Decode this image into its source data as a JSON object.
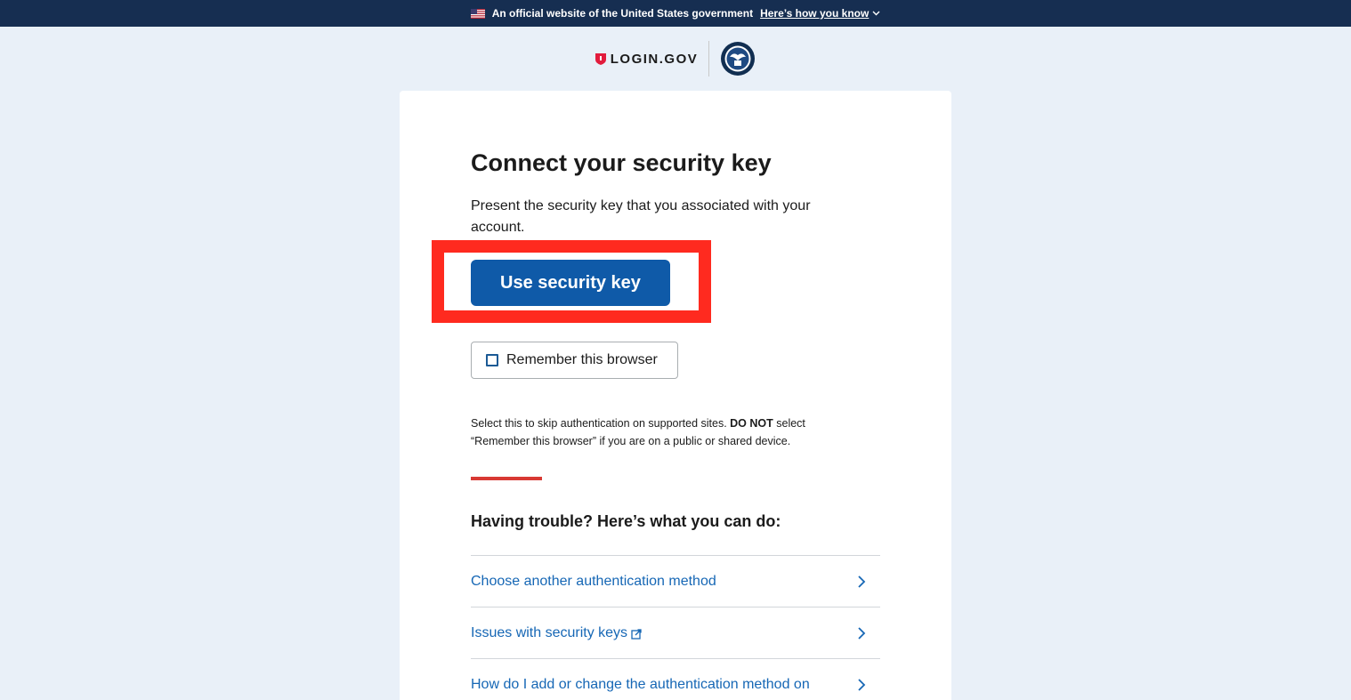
{
  "banner": {
    "official_text": "An official website of the United States government",
    "how_link": "Here’s how you know",
    "flag_icon": "us-flag-icon"
  },
  "header": {
    "logo_text": "LOGIN.GOV",
    "logo_icon": "login-shield-icon",
    "seal": "agency-seal"
  },
  "main": {
    "title": "Connect your security key",
    "intro": "Present the security key that you associated with your account.",
    "primary_button": "Use security key",
    "remember_label": "Remember this browser",
    "remember_checked": false,
    "hint_part1": "Select this to skip authentication on supported sites. ",
    "hint_bold": "DO NOT",
    "hint_part2": " select “Remember this browser” if you are on a public or shared device."
  },
  "trouble": {
    "heading": "Having trouble? Here’s what you can do:",
    "items": [
      {
        "label": "Choose another authentication method",
        "external": false
      },
      {
        "label": "Issues with security keys",
        "external": true
      },
      {
        "label": "How do I add or change the authentication method on",
        "external": false
      }
    ]
  },
  "colors": {
    "banner_bg": "#162e51",
    "primary": "#0f5aa8",
    "link": "#1667b5",
    "accent_red": "#d83933",
    "highlight": "#ff2a1f",
    "page_bg": "#e9f0f8"
  }
}
